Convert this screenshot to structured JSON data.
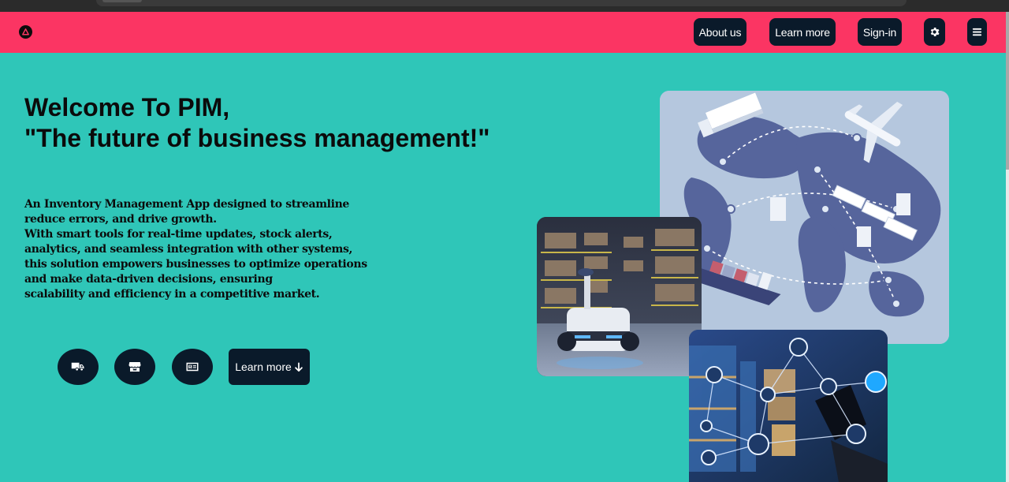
{
  "nav": {
    "logo_icon": "a-logo-icon",
    "about_label": "About us",
    "learn_label": "Learn more",
    "signin_label": "Sign-in",
    "settings_icon": "gear-icon",
    "menu_icon": "hamburger-menu-icon"
  },
  "hero": {
    "title_line1": "Welcome To PIM,",
    "title_line2": "\"The future of business management!\"",
    "description_lines": [
      "An Inventory Management App designed to streamline",
      "reduce errors, and drive growth.",
      "With smart tools for real-time updates, stock alerts,",
      "analytics, and seamless integration with other systems,",
      "this solution empowers businesses to optimize operations",
      "and make data-driven decisions, ensuring",
      "scalability and efficiency in a competitive market."
    ],
    "actions": {
      "truck_icon": "truck-icon",
      "store_icon": "store-icon",
      "card_icon": "id-card-icon",
      "learn_more_label": "Learn more",
      "arrow_icon": "arrow-down-icon"
    }
  },
  "images": {
    "map": "world-logistics-map-image",
    "robot": "warehouse-robot-image",
    "network": "warehouse-network-image"
  },
  "colors": {
    "background": "#2fc6b8",
    "navbar": "#fb3563",
    "button": "#0a1a2a"
  }
}
